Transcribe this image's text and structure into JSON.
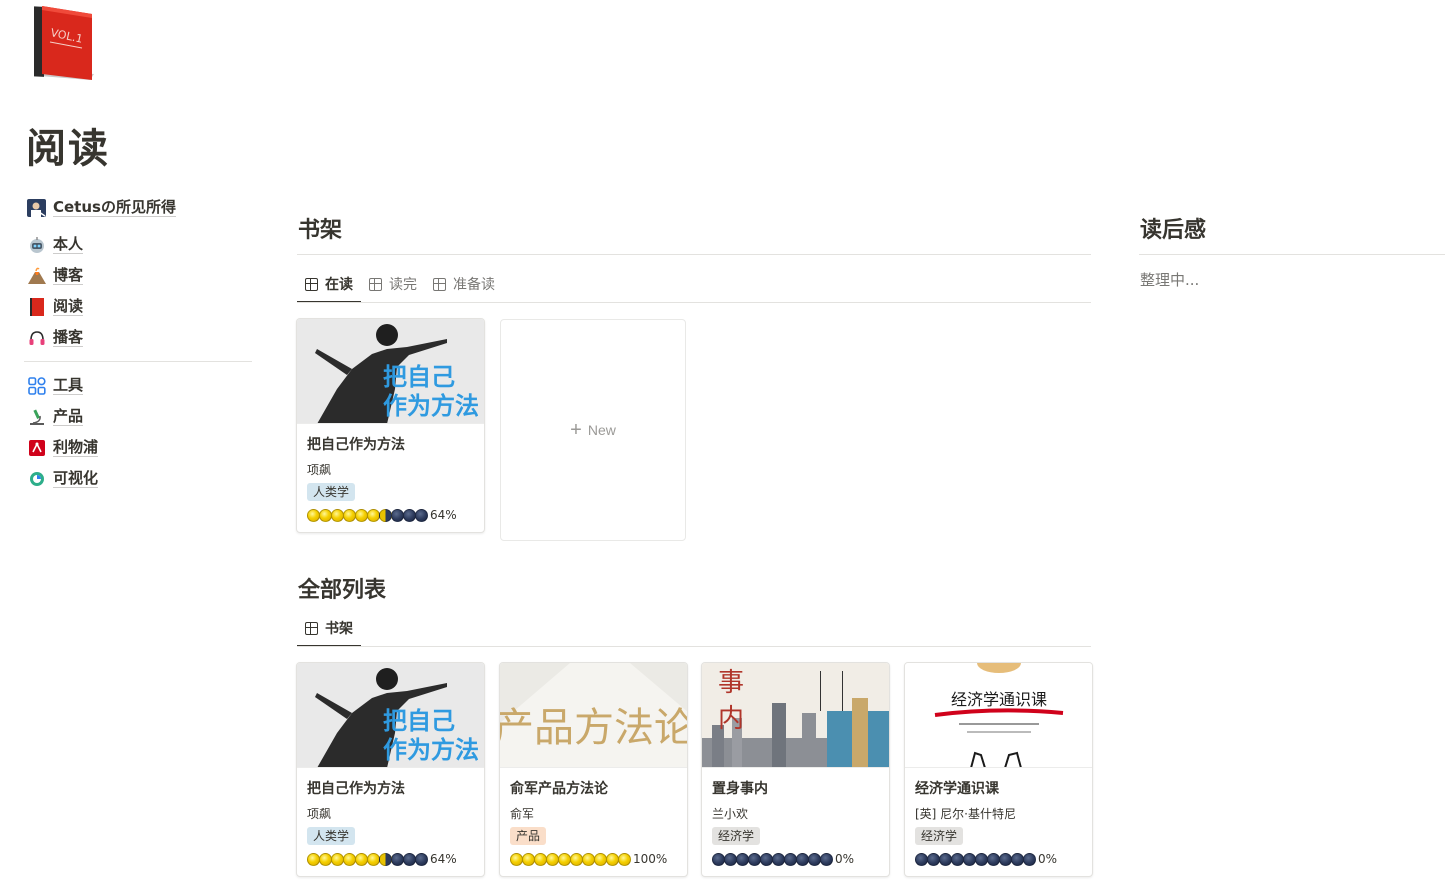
{
  "page": {
    "title": "阅读",
    "icon": "red-book-vol1-icon",
    "icon_text": "VOL.1"
  },
  "nav": [
    {
      "label": "Cetusの所见所得",
      "icon": "avatar-icon"
    },
    {
      "label": "本人",
      "icon": "robot-icon"
    },
    {
      "label": "博客",
      "icon": "volcano-icon"
    },
    {
      "label": "阅读",
      "icon": "red-book-icon"
    },
    {
      "label": "播客",
      "icon": "headphones-icon"
    },
    {
      "label": "工具",
      "icon": "apps-grid-icon"
    },
    {
      "label": "产品",
      "icon": "microscope-icon"
    },
    {
      "label": "利物浦",
      "icon": "liverpool-crest-icon"
    },
    {
      "label": "可视化",
      "icon": "chart-circle-icon"
    }
  ],
  "shelf": {
    "heading": "书架",
    "tabs": [
      {
        "label": "在读",
        "active": true
      },
      {
        "label": "读完",
        "active": false
      },
      {
        "label": "准备读",
        "active": false
      }
    ],
    "new_label": "New"
  },
  "all_list": {
    "heading": "全部列表",
    "tabs": [
      {
        "label": "书架",
        "active": true
      }
    ]
  },
  "after_reading": {
    "heading": "读后感",
    "text": "整理中..."
  },
  "books": [
    {
      "title": "把自己作为方法",
      "author": "项飙",
      "tag": "人类学",
      "tag_color": "#d3e5ef",
      "progress": 0.64,
      "progress_label": "64%",
      "cover_text": [
        "把自己",
        "作为方法"
      ]
    },
    {
      "title": "俞军产品方法论",
      "author": "俞军",
      "tag": "产品",
      "tag_color": "#fadec9",
      "progress": 1.0,
      "progress_label": "100%",
      "cover_text": [
        "产品方法论"
      ]
    },
    {
      "title": "置身事内",
      "author": "兰小欢",
      "tag": "经济学",
      "tag_color": "#e3e2e0",
      "progress": 0.0,
      "progress_label": "0%",
      "cover_text": [
        "事",
        "内"
      ]
    },
    {
      "title": "经济学通识课",
      "author": "[英] 尼尔·基什特尼",
      "tag": "经济学",
      "tag_color": "#e3e2e0",
      "progress": 0.0,
      "progress_label": "0%",
      "cover_text": [
        "经济学通识课"
      ]
    }
  ],
  "colors": {
    "text": "#37352f",
    "muted": "#787774",
    "divider": "#e3e2df",
    "cover_blue": "#2f9ae0"
  }
}
